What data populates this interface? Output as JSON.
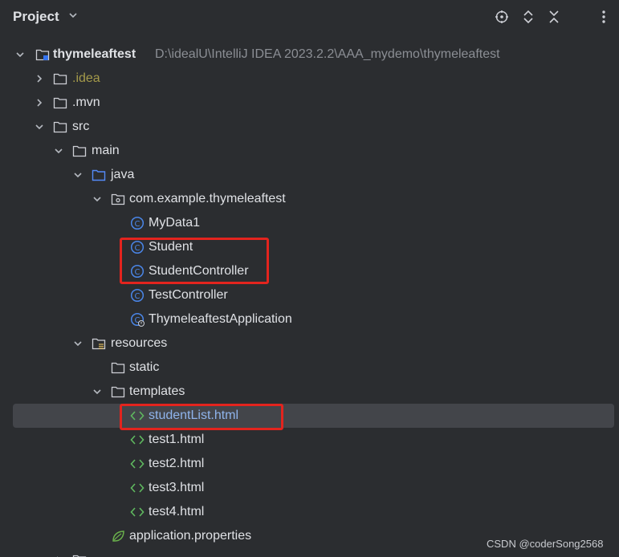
{
  "header": {
    "title": "Project",
    "icons": [
      "target-icon",
      "expand-collapse-icon",
      "collapse-all-icon",
      "more-icon"
    ]
  },
  "tree": {
    "root_name": "thymeleaftest",
    "root_path": "D:\\idealU\\IntelliJ IDEA 2023.2.2\\AAA_mydemo\\thymeleaftest",
    "idea": ".idea",
    "mvn": ".mvn",
    "src": "src",
    "main": "main",
    "java": "java",
    "package": "com.example.thymeleaftest",
    "classes": [
      "MyData1",
      "Student",
      "StudentController",
      "TestController",
      "ThymeleaftestApplication"
    ],
    "resources": "resources",
    "static": "static",
    "templates": "templates",
    "html_files": [
      "studentList.html",
      "test1.html",
      "test2.html",
      "test3.html",
      "test4.html"
    ],
    "properties": "application.properties"
  },
  "watermark": "CSDN @coderSong2568",
  "colors": {
    "background": "#2b2d30",
    "selection": "#43454a",
    "highlight_box": "#e3241e",
    "class_icon": "#4a86e8",
    "html_icon": "#5fb85f"
  }
}
